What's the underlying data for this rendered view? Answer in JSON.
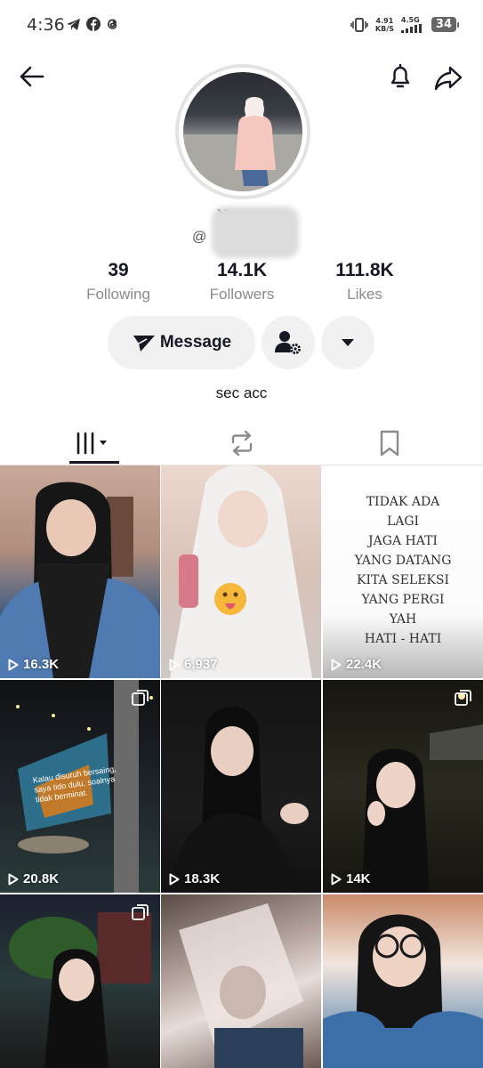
{
  "status_bar": {
    "time": "4:36",
    "net_speed_value": "4.91",
    "net_speed_unit": "KB/S",
    "network_type": "4.5G",
    "battery": "34"
  },
  "profile": {
    "username_visible": "Y",
    "handle_prefix": "@",
    "bio": "sec acc"
  },
  "stats": {
    "following": {
      "value": "39",
      "label": "Following"
    },
    "followers": {
      "value": "14.1K",
      "label": "Followers"
    },
    "likes": {
      "value": "111.8K",
      "label": "Likes"
    }
  },
  "actions": {
    "message_label": "Message"
  },
  "tile_overlay_text": {
    "quote_lines": [
      "TIDAK ADA",
      "LAGI",
      "JAGA HATI",
      "YANG DATANG",
      "KITA SELEKSI",
      "YANG PERGI",
      "YAH",
      "HATI - HATI"
    ],
    "caption": "Kalau disuruh bersaing, saya tido dulu, soalnya tidak berminat."
  },
  "videos": [
    {
      "views": "16.3K"
    },
    {
      "views": "6,937"
    },
    {
      "views": "22.4K"
    },
    {
      "views": "20.8K"
    },
    {
      "views": "18.3K"
    },
    {
      "views": "14K"
    },
    {
      "views": ""
    },
    {
      "views": ""
    },
    {
      "views": ""
    }
  ],
  "colors": {
    "text_primary": "#161823",
    "text_secondary": "#8a8b91",
    "button_bg": "#f1f1f2"
  }
}
